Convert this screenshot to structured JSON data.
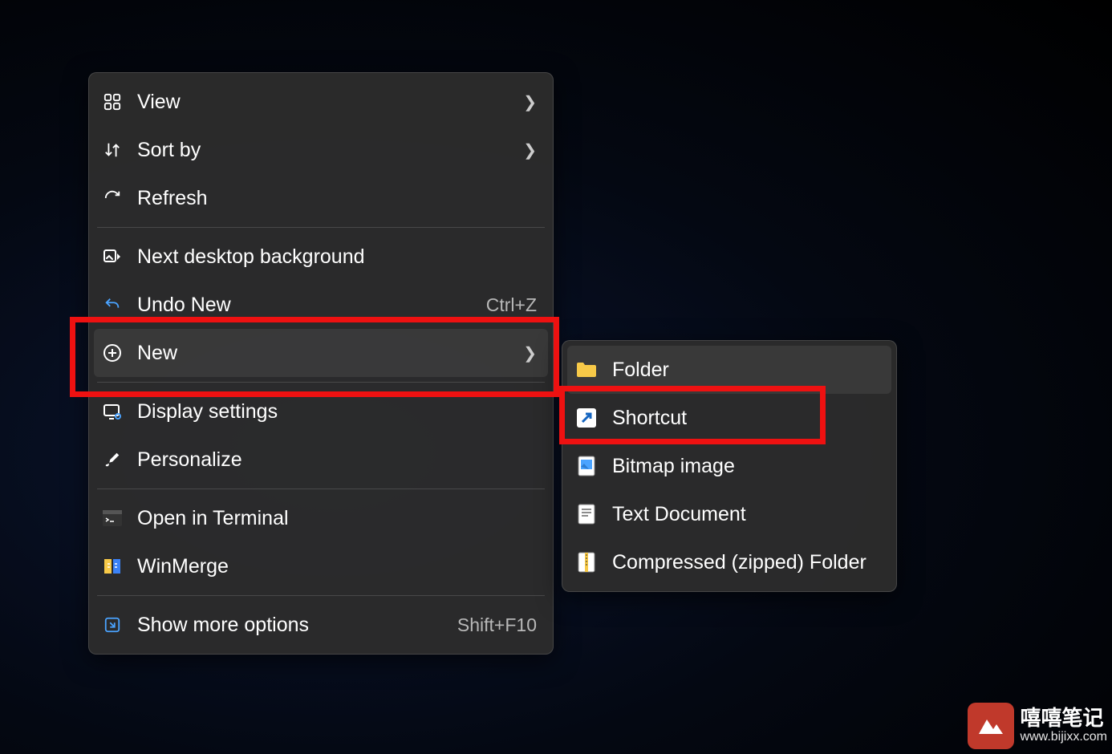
{
  "main_menu": {
    "items": [
      {
        "label": "View",
        "shortcut": "",
        "has_submenu": true
      },
      {
        "label": "Sort by",
        "shortcut": "",
        "has_submenu": true
      },
      {
        "label": "Refresh",
        "shortcut": "",
        "has_submenu": false
      },
      {
        "divider": true
      },
      {
        "label": "Next desktop background",
        "shortcut": "",
        "has_submenu": false
      },
      {
        "label": "Undo New",
        "shortcut": "Ctrl+Z",
        "has_submenu": false
      },
      {
        "label": "New",
        "shortcut": "",
        "has_submenu": true,
        "hover": true
      },
      {
        "divider": true
      },
      {
        "label": "Display settings",
        "shortcut": "",
        "has_submenu": false
      },
      {
        "label": "Personalize",
        "shortcut": "",
        "has_submenu": false
      },
      {
        "divider": true
      },
      {
        "label": "Open in Terminal",
        "shortcut": "",
        "has_submenu": false
      },
      {
        "label": "WinMerge",
        "shortcut": "",
        "has_submenu": false
      },
      {
        "divider": true
      },
      {
        "label": "Show more options",
        "shortcut": "Shift+F10",
        "has_submenu": false
      }
    ]
  },
  "sub_menu": {
    "items": [
      {
        "label": "Folder",
        "hover": true
      },
      {
        "label": "Shortcut"
      },
      {
        "label": "Bitmap image"
      },
      {
        "label": "Text Document"
      },
      {
        "label": "Compressed (zipped) Folder"
      }
    ]
  },
  "watermark": {
    "title": "嘻嘻笔记",
    "url": "www.bijixx.com"
  },
  "highlights": {
    "main": "New",
    "sub": "Shortcut"
  }
}
